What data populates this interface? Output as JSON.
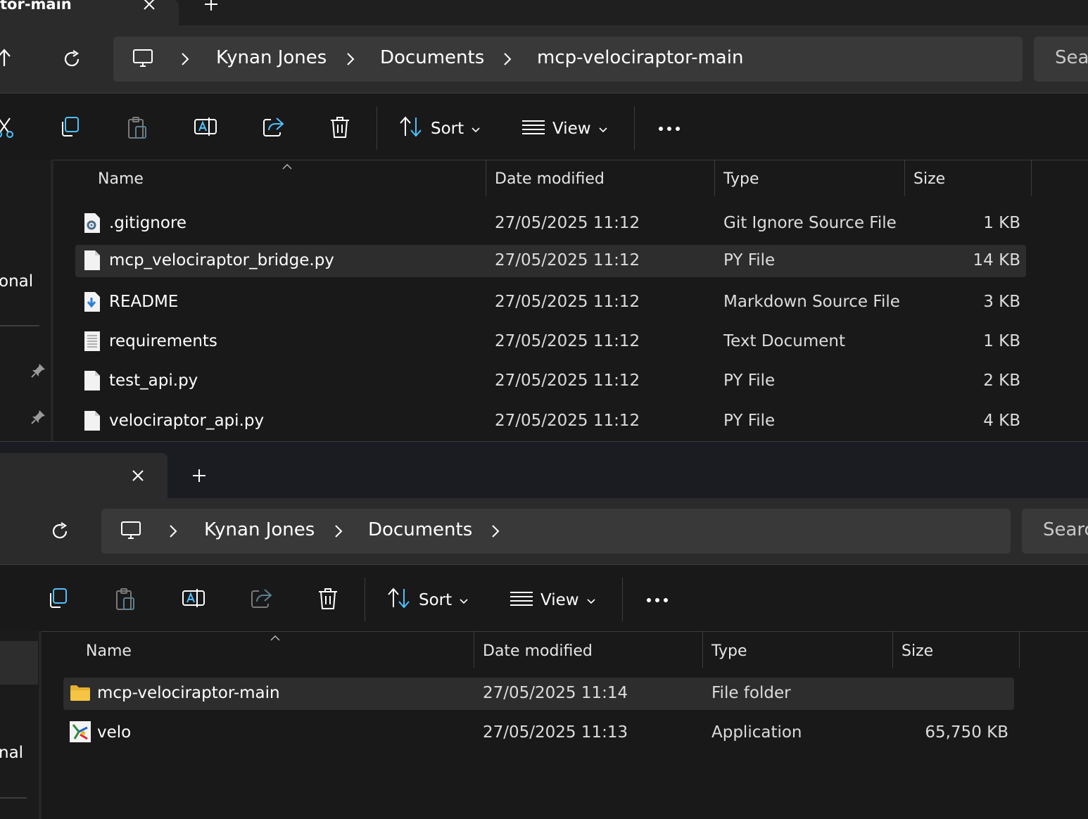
{
  "top_window": {
    "tab": {
      "title": "tor-main"
    },
    "address": {
      "crumbs": [
        "Kynan Jones",
        "Documents",
        "mcp-velociraptor-main"
      ]
    },
    "search": {
      "placeholder": "Sear"
    },
    "toolbar": {
      "sort_label": "Sort",
      "view_label": "View"
    },
    "sidebar": {
      "partial_label": "onal"
    },
    "columns": {
      "name": "Name",
      "date": "Date modified",
      "type": "Type",
      "size": "Size"
    },
    "files": [
      {
        "name": ".gitignore",
        "date": "27/05/2025 11:12",
        "type": "Git Ignore Source File",
        "size": "1 KB",
        "icon": "gear-file-icon",
        "selected": false
      },
      {
        "name": "mcp_velociraptor_bridge.py",
        "date": "27/05/2025 11:12",
        "type": "PY File",
        "size": "14 KB",
        "icon": "blank-file-icon",
        "selected": true
      },
      {
        "name": "README",
        "date": "27/05/2025 11:12",
        "type": "Markdown Source File",
        "size": "3 KB",
        "icon": "markdown-file-icon",
        "selected": false
      },
      {
        "name": "requirements",
        "date": "27/05/2025 11:12",
        "type": "Text Document",
        "size": "1 KB",
        "icon": "text-file-icon",
        "selected": false
      },
      {
        "name": "test_api.py",
        "date": "27/05/2025 11:12",
        "type": "PY File",
        "size": "2 KB",
        "icon": "blank-file-icon",
        "selected": false
      },
      {
        "name": "velociraptor_api.py",
        "date": "27/05/2025 11:12",
        "type": "PY File",
        "size": "4 KB",
        "icon": "blank-file-icon",
        "selected": false
      }
    ]
  },
  "bottom_window": {
    "address": {
      "crumbs": [
        "Kynan Jones",
        "Documents"
      ]
    },
    "search": {
      "placeholder": "Searc"
    },
    "toolbar": {
      "sort_label": "Sort",
      "view_label": "View"
    },
    "sidebar": {
      "partial_label": "nal"
    },
    "columns": {
      "name": "Name",
      "date": "Date modified",
      "type": "Type",
      "size": "Size"
    },
    "files": [
      {
        "name": "mcp-velociraptor-main",
        "date": "27/05/2025 11:14",
        "type": "File folder",
        "size": "",
        "icon": "folder-icon",
        "selected": true
      },
      {
        "name": "velo",
        "date": "27/05/2025 11:13",
        "type": "Application",
        "size": "65,750 KB",
        "icon": "application-icon",
        "selected": false
      }
    ]
  },
  "colors": {
    "bg": "#191919",
    "chrome": "#2b2b2b",
    "address": "#393939",
    "selected_row": "#2d2d2d",
    "accent": "#4cc2ff",
    "folder": "#f5c445"
  }
}
